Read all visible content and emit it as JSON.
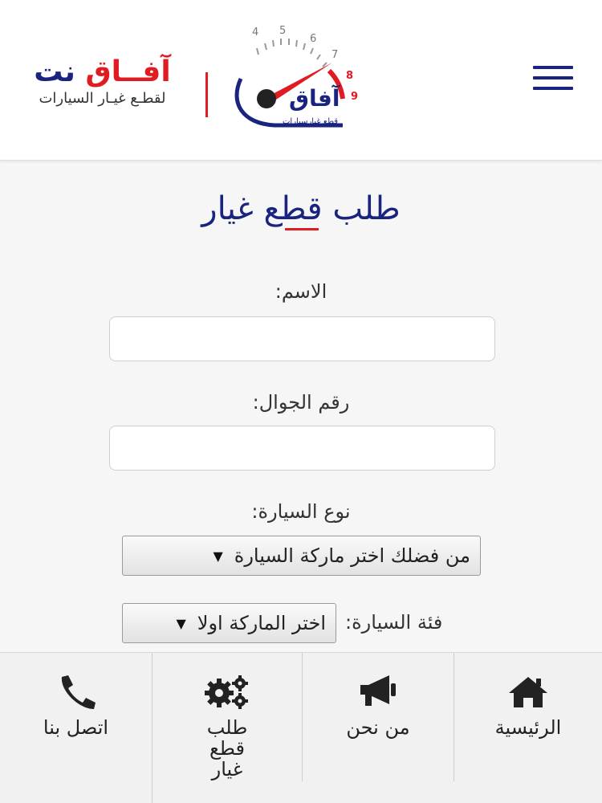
{
  "header": {
    "brand_part_red": "آفــاق",
    "brand_part_blue": "نت",
    "brand_tagline": "لقطـع غيـار السيارات",
    "logo_text": "آفاق",
    "logo_subtext": "قطع غيارسيارات",
    "gauge_numbers": [
      "4",
      "5",
      "6",
      "7",
      "8",
      "9"
    ],
    "colors": {
      "red": "#e11b22",
      "navy": "#1a237e"
    }
  },
  "form": {
    "title": "طلب قطع غيار",
    "name_label": "الاسم:",
    "name_value": "",
    "mobile_label": "رقم الجوال:",
    "mobile_value": "",
    "car_type_label": "نوع السيارة:",
    "car_type_selected": "من فضلك اختر ماركة السيارة",
    "car_class_label": "فئة السيارة:",
    "car_class_selected": "اختر الماركة اولا"
  },
  "bottom_nav": {
    "items": [
      {
        "label": "الرئيسية",
        "icon": "home-icon"
      },
      {
        "label": "من نحن",
        "icon": "megaphone-icon"
      },
      {
        "label": "طلب\nقطع\nغيار",
        "icon": "gears-icon"
      },
      {
        "label": "اتصل بنا",
        "icon": "phone-icon"
      }
    ]
  }
}
